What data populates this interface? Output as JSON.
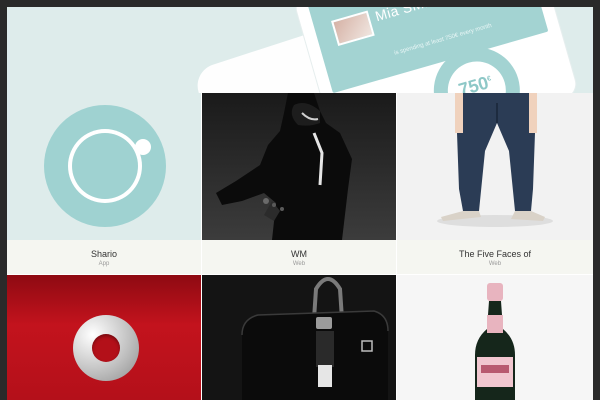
{
  "hero": {
    "profile_name": "Mia SMI",
    "tagline": "is spending at least 750€ every month",
    "spend_value": "750",
    "currency_symbol": "€"
  },
  "tiles": [
    {
      "title": "Shario",
      "subtitle": "App"
    },
    {
      "title": "WM",
      "subtitle": "Web"
    },
    {
      "title": "The Five Faces of",
      "subtitle": "Web"
    }
  ],
  "icons": {
    "shario_logo": "ring-logo-icon",
    "red_logo": "silver-ring-logo-icon",
    "bag": "handbag-icon",
    "bottle": "champagne-bottle-icon"
  },
  "colors": {
    "background_dark": "#2a2a2a",
    "teal": "#9fd2d1",
    "teal_light": "#deeceb",
    "caption_bg": "#f5f6f1",
    "red": "#c3131d"
  }
}
